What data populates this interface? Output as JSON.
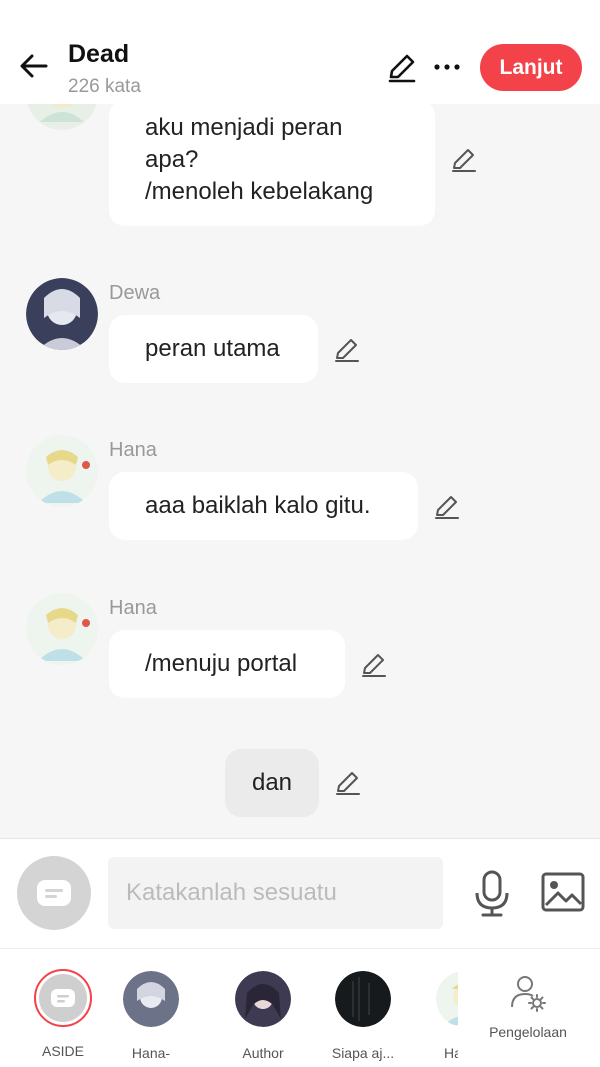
{
  "header": {
    "title": "Dead",
    "subtitle": "226 kata",
    "continue_label": "Lanjut",
    "icons": {
      "back": "back-arrow-icon",
      "edit": "pencil-icon",
      "more": "more-icon"
    }
  },
  "messages": [
    {
      "speaker": "",
      "avatar": "hana",
      "lines": [
        "aku menjadi peran",
        "apa?",
        "/menoleh kebelakang"
      ]
    },
    {
      "speaker": "Dewa",
      "avatar": "dewa",
      "lines": [
        "peran utama"
      ]
    },
    {
      "speaker": "Hana",
      "avatar": "hana",
      "lines": [
        "aaa baiklah kalo gitu."
      ]
    },
    {
      "speaker": "Hana",
      "avatar": "hana",
      "lines": [
        "/menuju portal"
      ]
    },
    {
      "speaker": "",
      "avatar": "",
      "lines": [
        "dan"
      ]
    }
  ],
  "input": {
    "placeholder": "Katakanlah sesuatu",
    "icons": {
      "aside": "aside-chat-icon",
      "mic": "microphone-icon",
      "image": "image-icon"
    }
  },
  "characters": [
    {
      "label": "ASIDE"
    },
    {
      "label": "Hana-"
    },
    {
      "label": "Author"
    },
    {
      "label": "Siapa aj..."
    },
    {
      "label": "Ha"
    }
  ],
  "management": {
    "label": "Pengelolaan",
    "icon": "user-settings-icon"
  },
  "colors": {
    "accent": "#f4424a",
    "background": "#f6f6f6",
    "bubble": "#ffffff",
    "narration_bubble": "#ebebeb"
  }
}
